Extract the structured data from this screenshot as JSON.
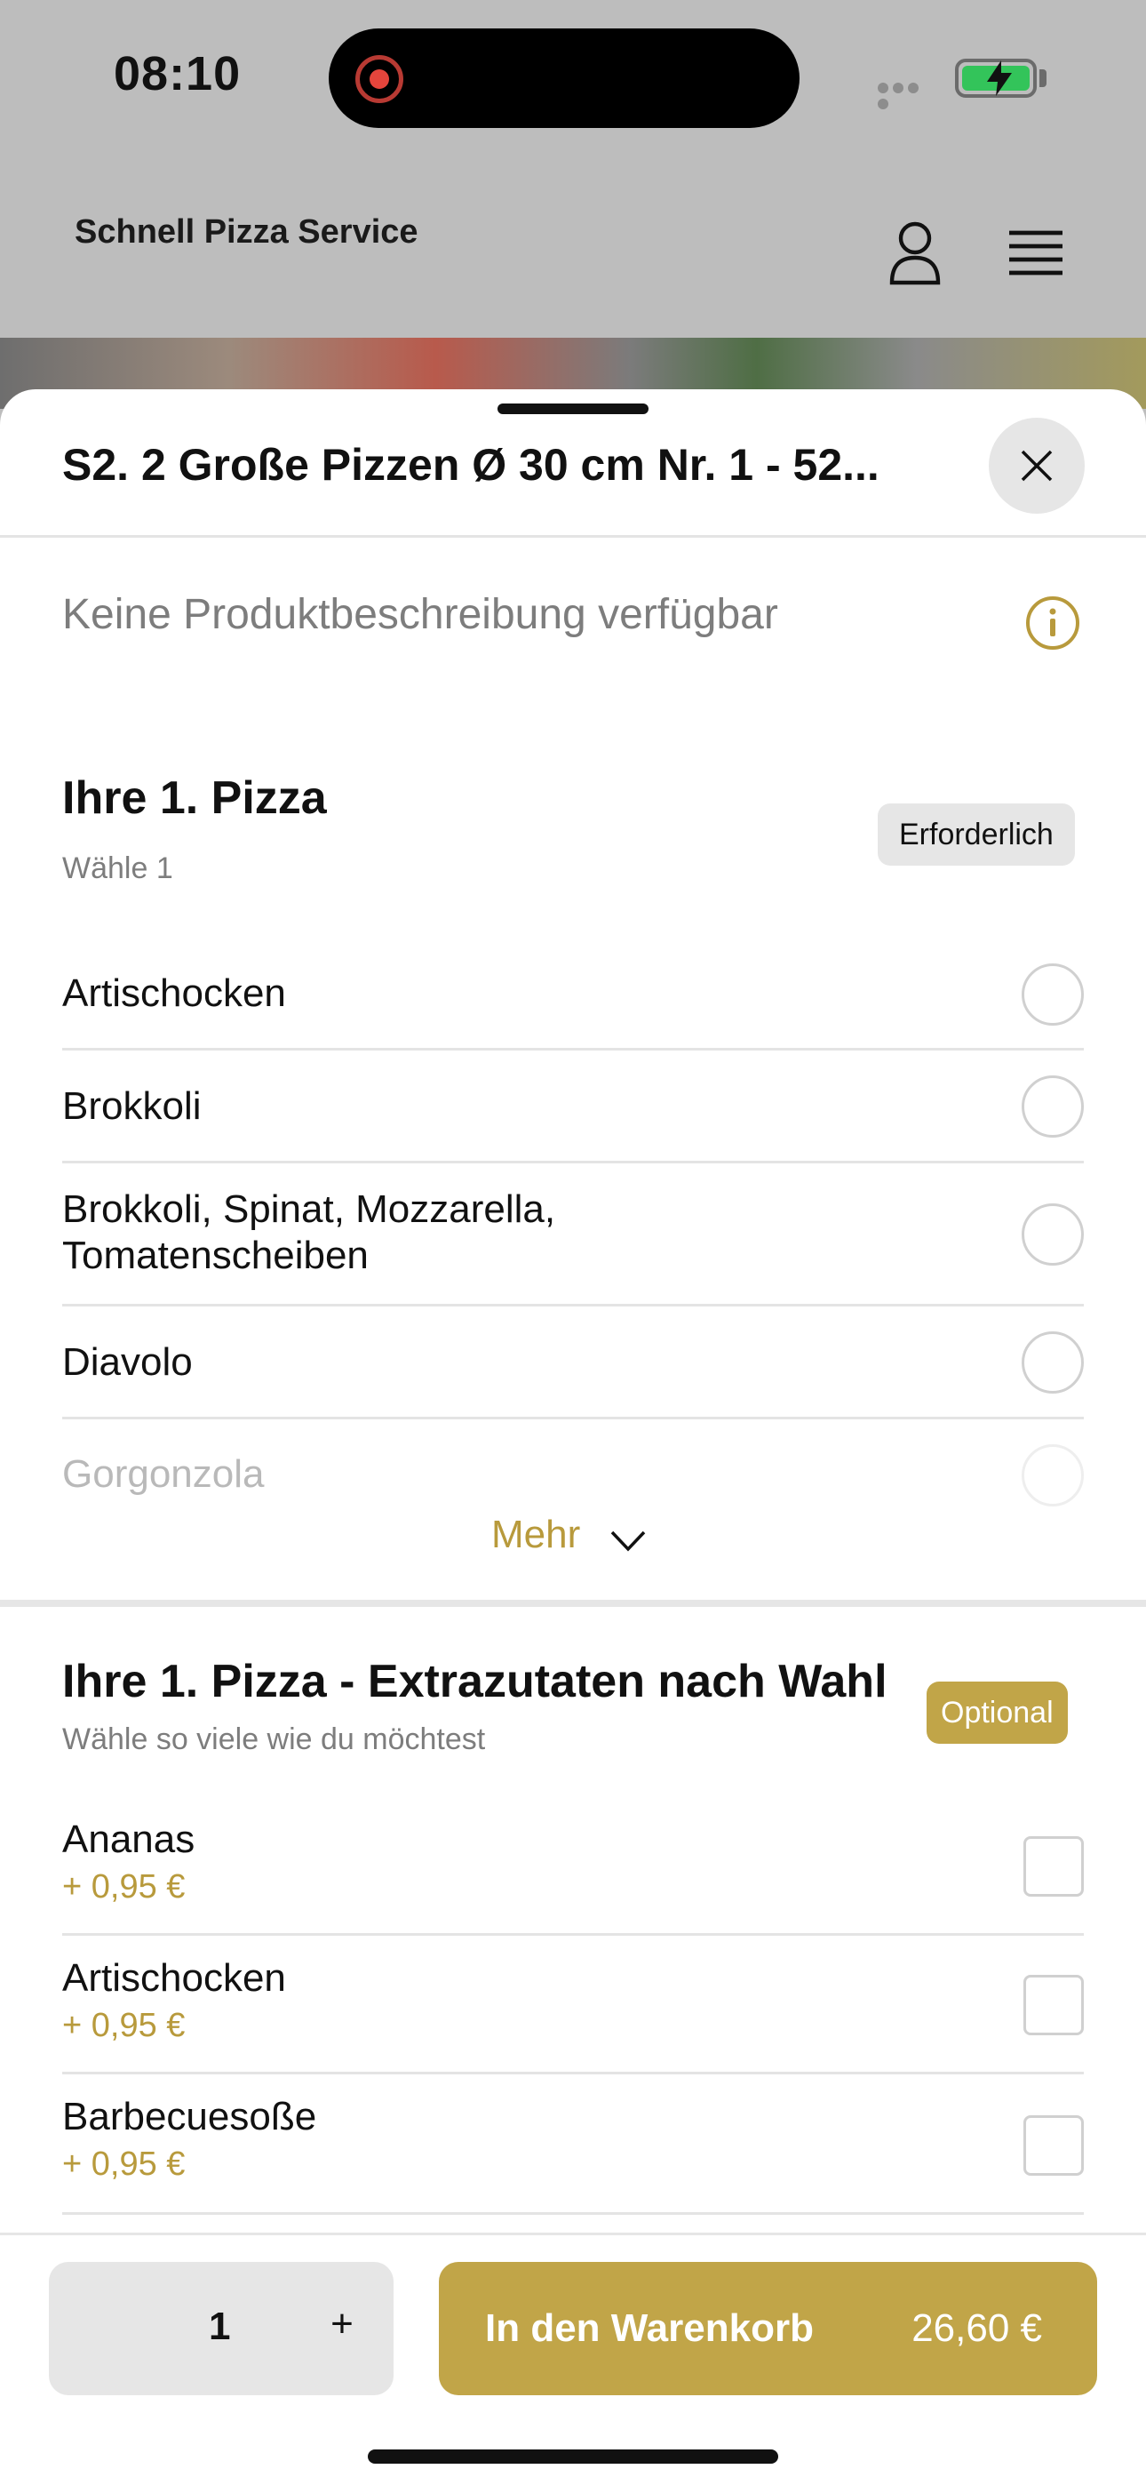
{
  "status_bar": {
    "time": "08:10"
  },
  "header": {
    "brand": "Schnell Pizza Service"
  },
  "product": {
    "title": "S2. 2 Große Pizzen Ø 30 cm Nr. 1 - 52...",
    "description": "Keine Produktbeschreibung verfügbar"
  },
  "group1": {
    "title": "Ihre 1. Pizza",
    "subtitle": "Wähle 1",
    "badge": "Erforderlich",
    "options": [
      {
        "label": "Artischocken"
      },
      {
        "label": "Brokkoli"
      },
      {
        "label": "Brokkoli, Spinat, Mozzarella, Tomatenscheiben"
      },
      {
        "label": "Diavolo"
      },
      {
        "label": "Gorgonzola"
      }
    ],
    "more_label": "Mehr"
  },
  "group2": {
    "title": "Ihre 1. Pizza - Extrazutaten nach Wahl",
    "subtitle": "Wähle so viele wie du möchtest",
    "badge": "Optional",
    "options": [
      {
        "label": "Ananas",
        "price": "+ 0,95 €"
      },
      {
        "label": "Artischocken",
        "price": "+ 0,95 €"
      },
      {
        "label": "Barbecuesoße",
        "price": "+ 0,95 €"
      }
    ]
  },
  "footer": {
    "quantity": "1",
    "plus": "+",
    "cart_label": "In den Warenkorb",
    "cart_price": "26,60 €"
  },
  "colors": {
    "accent": "#c1a548",
    "accent_text": "#b89a3c",
    "battery": "#33c45a"
  },
  "icons": [
    "record-icon",
    "battery-icon",
    "user-icon",
    "menu-icon",
    "close-icon",
    "info-icon",
    "chevron-down-icon"
  ]
}
